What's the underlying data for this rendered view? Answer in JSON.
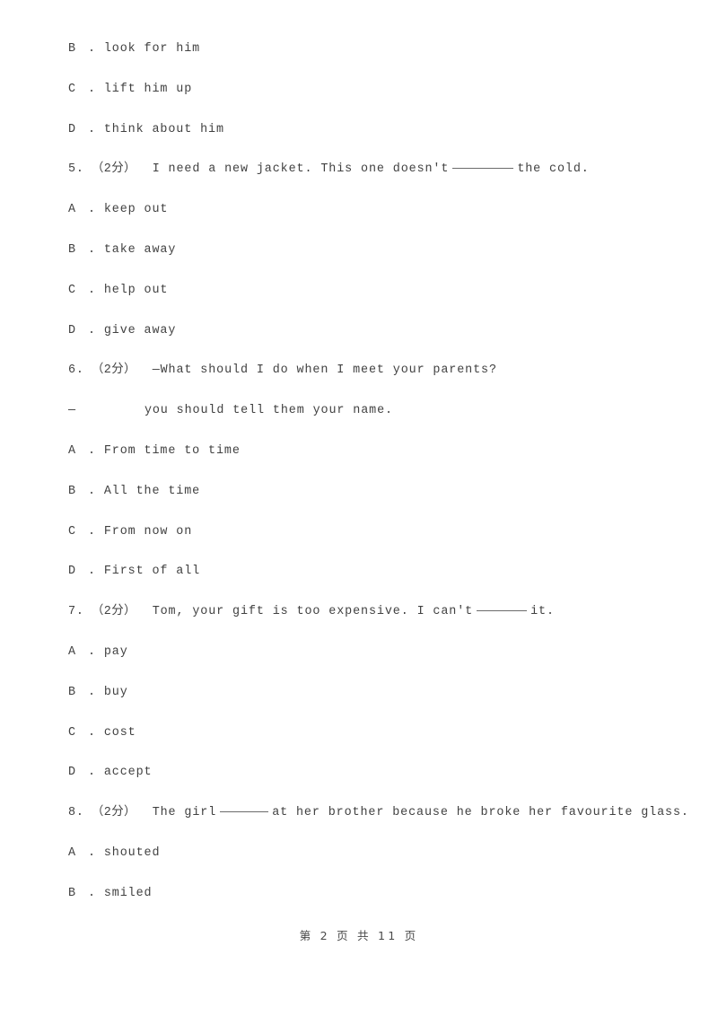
{
  "document": {
    "page_footer": "第 2 页 共 11 页",
    "text_color": "#414141",
    "background_color": "#ffffff"
  },
  "lines": [
    {
      "type": "option",
      "letter": "B",
      "sep": ".",
      "text": "look for him"
    },
    {
      "type": "option",
      "letter": "C",
      "sep": ".",
      "text": "lift him up"
    },
    {
      "type": "option",
      "letter": "D",
      "sep": ".",
      "text": "think about him"
    },
    {
      "type": "question",
      "number": "5.",
      "marks": "（2分）",
      "pre": "I need a new jacket. This one doesn't",
      "blank": "long",
      "post": "the cold."
    },
    {
      "type": "option",
      "letter": "A",
      "sep": ".",
      "text": "keep out"
    },
    {
      "type": "option",
      "letter": "B",
      "sep": ".",
      "text": "take away"
    },
    {
      "type": "option",
      "letter": "C",
      "sep": ".",
      "text": "help out"
    },
    {
      "type": "option",
      "letter": "D",
      "sep": ".",
      "text": "give away"
    },
    {
      "type": "question",
      "number": "6.",
      "marks": "（2分）",
      "pre": "—What should I do when I meet your parents?",
      "blank": "none",
      "post": ""
    },
    {
      "type": "dialogue",
      "dash": "—",
      "text": "you should tell them your name."
    },
    {
      "type": "option",
      "letter": "A",
      "sep": ".",
      "text": "From time to time"
    },
    {
      "type": "option",
      "letter": "B",
      "sep": ".",
      "text": "All the time"
    },
    {
      "type": "option",
      "letter": "C",
      "sep": ".",
      "text": "From now on"
    },
    {
      "type": "option",
      "letter": "D",
      "sep": ".",
      "text": "First of all"
    },
    {
      "type": "question",
      "number": "7.",
      "marks": "（2分）",
      "pre": "Tom, your gift is too expensive. I can't",
      "blank": "med",
      "post": "it."
    },
    {
      "type": "option",
      "letter": "A",
      "sep": ".",
      "text": "pay"
    },
    {
      "type": "option",
      "letter": "B",
      "sep": ".",
      "text": "buy"
    },
    {
      "type": "option",
      "letter": "C",
      "sep": ".",
      "text": "cost"
    },
    {
      "type": "option",
      "letter": "D",
      "sep": ".",
      "text": "accept"
    },
    {
      "type": "question",
      "number": "8.",
      "marks": "（2分）",
      "pre": "The girl",
      "blank": "short",
      "post": "at her brother because he broke her favourite glass."
    },
    {
      "type": "option",
      "letter": "A",
      "sep": ".",
      "text": "shouted"
    },
    {
      "type": "option",
      "letter": "B",
      "sep": ".",
      "text": "smiled"
    }
  ]
}
